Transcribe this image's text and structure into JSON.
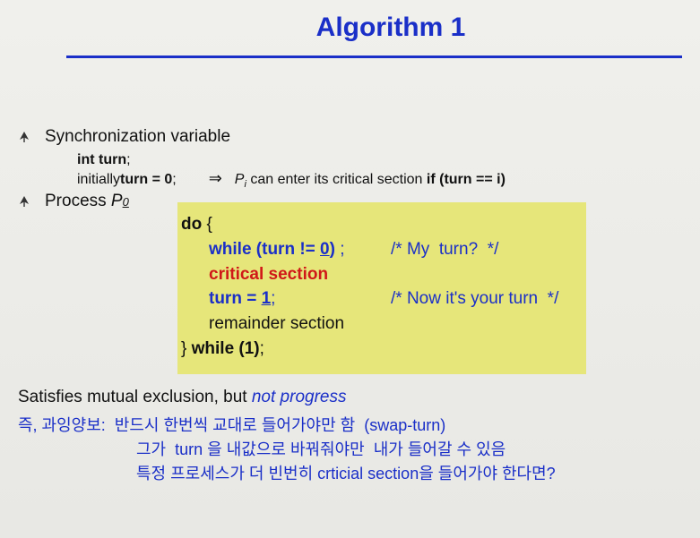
{
  "slide": {
    "title": "Algorithm 1",
    "bullets": [
      {
        "label": "Synchronization variable"
      },
      {
        "label_prefix": "Process ",
        "label_var": "P",
        "label_sub": "0"
      }
    ],
    "sync": {
      "line1": "int turn",
      "line1_suffix": ";",
      "line2_prefix": "initially ",
      "line2_bold": "turn = 0",
      "line2_suffix": ";",
      "arrow": "⇒",
      "pi_var": "P",
      "pi_sub": "i",
      "pi_text": " can enter its critical section ",
      "if_text": "if (turn == i)"
    },
    "code": {
      "do": "do",
      "brace_open": " {",
      "while_kw": "while (turn != ",
      "while_num": "0",
      "while_close": ")",
      "while_semi": " ;",
      "comment1": "/* My  turn?  */",
      "critical": "critical section",
      "turn_assign": "turn = ",
      "turn_num": "1",
      "turn_semi": ";",
      "comment2": "/* Now it's your turn  */",
      "remainder": "remainder section",
      "close": "} ",
      "end_while": "while (1)",
      "end_semi": ";"
    },
    "footer": {
      "main": "Satisfies mutual exclusion, but ",
      "main_it": "not progress",
      "kor1": "즉, 과잉양보:  반드시 한번씩 교대로 들어가야만 함  (swap-turn)",
      "kor2": "그가  turn 을 내값으로 바꿔줘야만  내가 들어갈 수 있음",
      "kor3": "특정 프로세스가 더 빈번히 crticial section을 들어가야 한다면?"
    },
    "colors": {
      "accent": "#1a2fc8",
      "codebox": "#e6e67a",
      "critical": "#d01818"
    }
  }
}
